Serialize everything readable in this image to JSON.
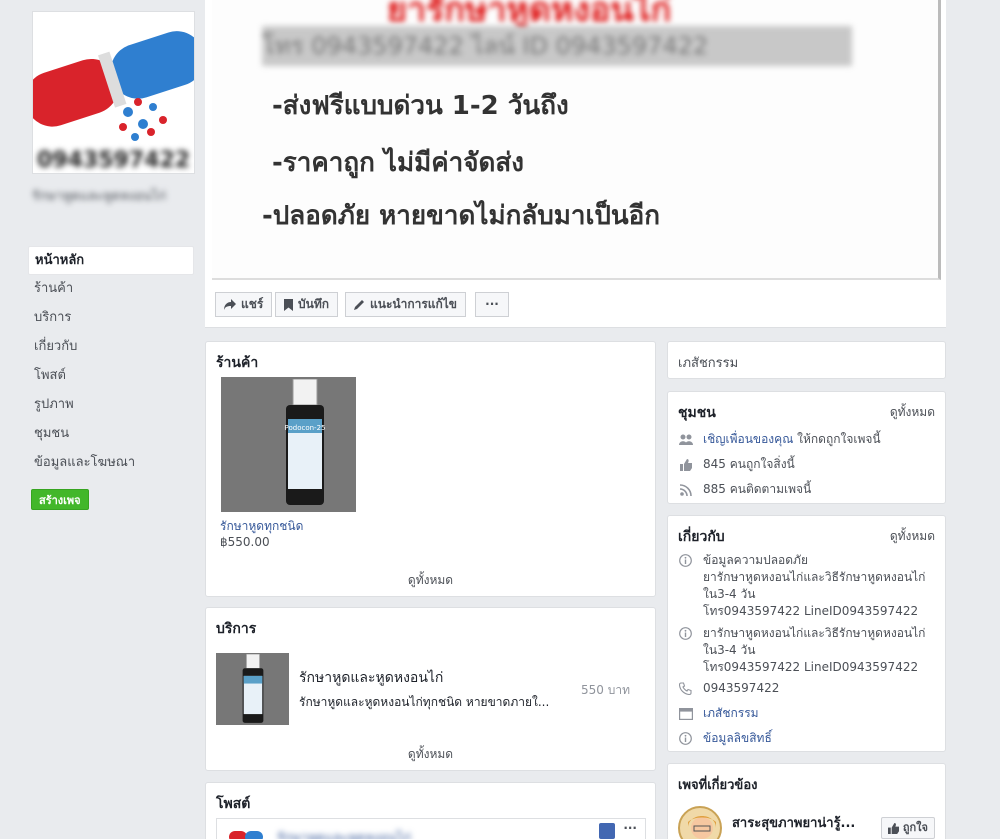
{
  "left": {
    "profile_phone": "0943597422",
    "page_name": "รักษาหูดและหูดหงอนไก่",
    "nav": [
      "หน้าหลัก",
      "ร้านค้า",
      "บริการ",
      "เกี่ยวกับ",
      "โพสต์",
      "รูปภาพ",
      "ชุมชน",
      "ข้อมูลและโฆษณา"
    ],
    "create_page": "สร้างเพจ"
  },
  "cover": {
    "headline": "ยารักษาหูดหงอนไก่",
    "sub": "โทร 0943597422 ไลน์ ID 0943597422",
    "lines": [
      "-ส่งฟรีแบบด่วน 1-2 วันถึง",
      "-ราคาถูก ไม่มีค่าจัดส่ง",
      "-ปลอดภัย หายขาดไม่กลับมาเป็นอีก"
    ]
  },
  "actions": {
    "share": "แชร์",
    "save": "บันทึก",
    "suggest": "แนะนำการแก้ไข",
    "more": "···"
  },
  "shop": {
    "title": "ร้านค้า",
    "product_name": "รักษาหูดทุกชนิด",
    "product_price": "฿550.00",
    "see_all": "ดูทั้งหมด",
    "bottle_label": "Podocon-25"
  },
  "services": {
    "title": "บริการ",
    "name": "รักษาหูดและหูดหงอนไก่",
    "desc": "รักษาหูดและหูดหงอนไก่ทุกชนิด หายขาดภายใ...",
    "price": "550 บาท",
    "see_all": "ดูทั้งหมด"
  },
  "posts": {
    "title": "โพสต์",
    "preview": "รักษาหูดและหูดหงอนไก่"
  },
  "right": {
    "category": "เภสัชกรรม",
    "community": {
      "title": "ชุมชน",
      "see_all": "ดูทั้งหมด",
      "invite_link": "เชิญเพื่อนของคุณ",
      "invite_rest": " ให้กดถูกใจเพจนี้",
      "likes": "845 คนถูกใจสิ่งนี้",
      "follows": "885 คนติดตามเพจนี้"
    },
    "about": {
      "title": "เกี่ยวกับ",
      "see_all": "ดูทั้งหมด",
      "info1": [
        "ข้อมูลความปลอดภัย",
        "ยารักษาหูดหงอนไก่และวิธีรักษาหูดหงอนไก่",
        "ใน3-4 วัน",
        "โทร0943597422 LineID0943597422"
      ],
      "info2": [
        "ยารักษาหูดหงอนไก่และวิธีรักษาหูดหงอนไก่",
        "ใน3-4 วัน",
        "โทร0943597422 LineID0943597422"
      ],
      "phone": "0943597422",
      "category": "เภสัชกรรม",
      "copyright": "ข้อมูลลิขสิทธิ์"
    },
    "related": {
      "title": "เพจที่เกี่ยวข้อง",
      "page_name": "สาระสุขภาพยาน่ารู้...",
      "like_label": "ถูกใจ"
    }
  }
}
